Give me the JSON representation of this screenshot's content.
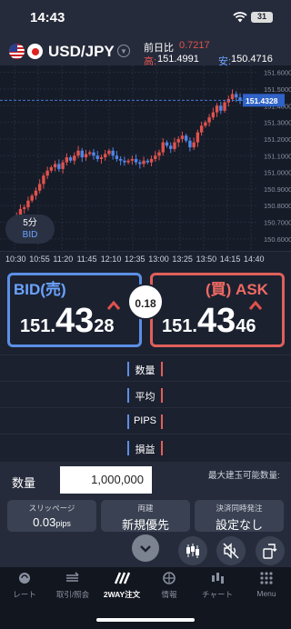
{
  "status": {
    "time": "14:43",
    "battery": "31"
  },
  "header": {
    "pair": "USD/JPY",
    "change_label": "前日比",
    "change_value": "0.7217",
    "high_label": "高:",
    "high_value": "151.4991",
    "low_label": "安:",
    "low_value": "150.4716"
  },
  "chart": {
    "price_ticks": [
      "151.6000",
      "151.5000",
      "151.4000",
      "151.3000",
      "151.2000",
      "151.1000",
      "151.0000",
      "150.9000",
      "150.8000",
      "150.7000",
      "150.6000"
    ],
    "current_price_label": "151.4328",
    "timeframe": "5分",
    "side": "BID",
    "time_ticks": [
      "10:30",
      "10:55",
      "11:20",
      "11:45",
      "12:10",
      "12:35",
      "13:00",
      "13:25",
      "13:50",
      "14:15",
      "14:40"
    ]
  },
  "chart_data": {
    "type": "candlestick",
    "ylim": [
      150.55,
      151.62
    ],
    "current_price": 151.4328,
    "colors": {
      "up": "#e0524c",
      "down": "#4f86e8"
    }
  },
  "bid": {
    "title": "BID(売)",
    "price_prefix": "151.",
    "price_big": "43",
    "price_tail": "28"
  },
  "ask": {
    "title": "(買) ASK",
    "price_prefix": "151.",
    "price_big": "43",
    "price_tail": "46"
  },
  "spread": "0.18",
  "position_rows": [
    "数量",
    "平均",
    "PIPS",
    "損益"
  ],
  "order": {
    "qty_label": "数量",
    "qty_value": "1,000,000",
    "max_label": "最大建玉可能数量:",
    "slippage_caption": "スリッページ",
    "slippage_value": "0.03",
    "slippage_unit": "pips",
    "hedge_caption": "両建",
    "hedge_value": "新規優先",
    "settle_caption": "決済同時発注",
    "settle_value": "設定なし"
  },
  "tabs": [
    "レート",
    "取引/照会",
    "2WAY注文",
    "情報",
    "チャート",
    "Menu"
  ],
  "active_tab": "2WAY注文"
}
